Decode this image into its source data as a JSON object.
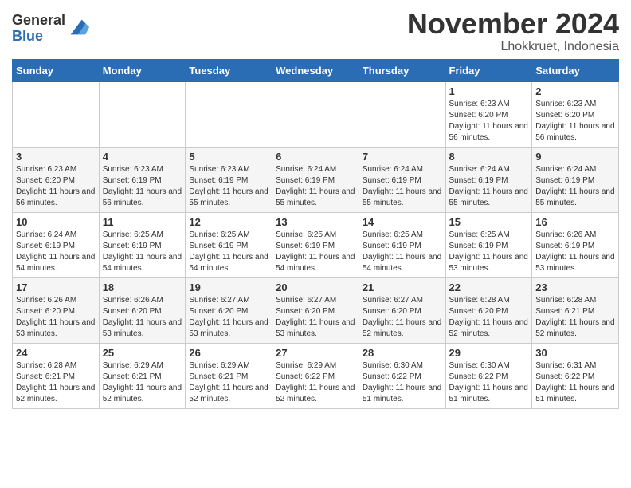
{
  "header": {
    "logo_general": "General",
    "logo_blue": "Blue",
    "month_title": "November 2024",
    "location": "Lhokkruet, Indonesia"
  },
  "days_of_week": [
    "Sunday",
    "Monday",
    "Tuesday",
    "Wednesday",
    "Thursday",
    "Friday",
    "Saturday"
  ],
  "weeks": [
    [
      {
        "day": "",
        "info": ""
      },
      {
        "day": "",
        "info": ""
      },
      {
        "day": "",
        "info": ""
      },
      {
        "day": "",
        "info": ""
      },
      {
        "day": "",
        "info": ""
      },
      {
        "day": "1",
        "info": "Sunrise: 6:23 AM\nSunset: 6:20 PM\nDaylight: 11 hours and 56 minutes."
      },
      {
        "day": "2",
        "info": "Sunrise: 6:23 AM\nSunset: 6:20 PM\nDaylight: 11 hours and 56 minutes."
      }
    ],
    [
      {
        "day": "3",
        "info": "Sunrise: 6:23 AM\nSunset: 6:20 PM\nDaylight: 11 hours and 56 minutes."
      },
      {
        "day": "4",
        "info": "Sunrise: 6:23 AM\nSunset: 6:19 PM\nDaylight: 11 hours and 56 minutes."
      },
      {
        "day": "5",
        "info": "Sunrise: 6:23 AM\nSunset: 6:19 PM\nDaylight: 11 hours and 55 minutes."
      },
      {
        "day": "6",
        "info": "Sunrise: 6:24 AM\nSunset: 6:19 PM\nDaylight: 11 hours and 55 minutes."
      },
      {
        "day": "7",
        "info": "Sunrise: 6:24 AM\nSunset: 6:19 PM\nDaylight: 11 hours and 55 minutes."
      },
      {
        "day": "8",
        "info": "Sunrise: 6:24 AM\nSunset: 6:19 PM\nDaylight: 11 hours and 55 minutes."
      },
      {
        "day": "9",
        "info": "Sunrise: 6:24 AM\nSunset: 6:19 PM\nDaylight: 11 hours and 55 minutes."
      }
    ],
    [
      {
        "day": "10",
        "info": "Sunrise: 6:24 AM\nSunset: 6:19 PM\nDaylight: 11 hours and 54 minutes."
      },
      {
        "day": "11",
        "info": "Sunrise: 6:25 AM\nSunset: 6:19 PM\nDaylight: 11 hours and 54 minutes."
      },
      {
        "day": "12",
        "info": "Sunrise: 6:25 AM\nSunset: 6:19 PM\nDaylight: 11 hours and 54 minutes."
      },
      {
        "day": "13",
        "info": "Sunrise: 6:25 AM\nSunset: 6:19 PM\nDaylight: 11 hours and 54 minutes."
      },
      {
        "day": "14",
        "info": "Sunrise: 6:25 AM\nSunset: 6:19 PM\nDaylight: 11 hours and 54 minutes."
      },
      {
        "day": "15",
        "info": "Sunrise: 6:25 AM\nSunset: 6:19 PM\nDaylight: 11 hours and 53 minutes."
      },
      {
        "day": "16",
        "info": "Sunrise: 6:26 AM\nSunset: 6:19 PM\nDaylight: 11 hours and 53 minutes."
      }
    ],
    [
      {
        "day": "17",
        "info": "Sunrise: 6:26 AM\nSunset: 6:20 PM\nDaylight: 11 hours and 53 minutes."
      },
      {
        "day": "18",
        "info": "Sunrise: 6:26 AM\nSunset: 6:20 PM\nDaylight: 11 hours and 53 minutes."
      },
      {
        "day": "19",
        "info": "Sunrise: 6:27 AM\nSunset: 6:20 PM\nDaylight: 11 hours and 53 minutes."
      },
      {
        "day": "20",
        "info": "Sunrise: 6:27 AM\nSunset: 6:20 PM\nDaylight: 11 hours and 53 minutes."
      },
      {
        "day": "21",
        "info": "Sunrise: 6:27 AM\nSunset: 6:20 PM\nDaylight: 11 hours and 52 minutes."
      },
      {
        "day": "22",
        "info": "Sunrise: 6:28 AM\nSunset: 6:20 PM\nDaylight: 11 hours and 52 minutes."
      },
      {
        "day": "23",
        "info": "Sunrise: 6:28 AM\nSunset: 6:21 PM\nDaylight: 11 hours and 52 minutes."
      }
    ],
    [
      {
        "day": "24",
        "info": "Sunrise: 6:28 AM\nSunset: 6:21 PM\nDaylight: 11 hours and 52 minutes."
      },
      {
        "day": "25",
        "info": "Sunrise: 6:29 AM\nSunset: 6:21 PM\nDaylight: 11 hours and 52 minutes."
      },
      {
        "day": "26",
        "info": "Sunrise: 6:29 AM\nSunset: 6:21 PM\nDaylight: 11 hours and 52 minutes."
      },
      {
        "day": "27",
        "info": "Sunrise: 6:29 AM\nSunset: 6:22 PM\nDaylight: 11 hours and 52 minutes."
      },
      {
        "day": "28",
        "info": "Sunrise: 6:30 AM\nSunset: 6:22 PM\nDaylight: 11 hours and 51 minutes."
      },
      {
        "day": "29",
        "info": "Sunrise: 6:30 AM\nSunset: 6:22 PM\nDaylight: 11 hours and 51 minutes."
      },
      {
        "day": "30",
        "info": "Sunrise: 6:31 AM\nSunset: 6:22 PM\nDaylight: 11 hours and 51 minutes."
      }
    ]
  ]
}
